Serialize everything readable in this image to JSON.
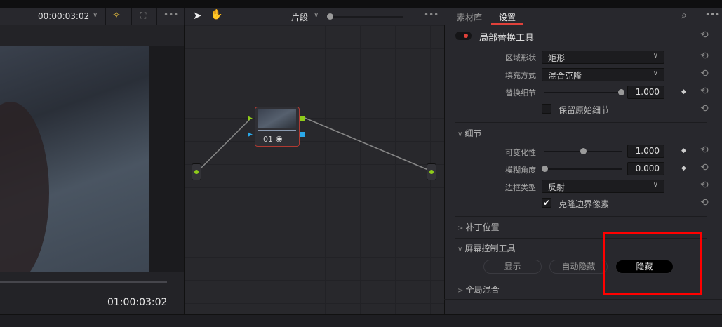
{
  "toolbar": {
    "timecode": "00:00:03:02",
    "clip_mode": "片段"
  },
  "viewer": {
    "timecode": "01:00:03:02"
  },
  "node": {
    "label": "01"
  },
  "panel": {
    "tabs": [
      {
        "label": "素材库"
      },
      {
        "label": "设置"
      }
    ],
    "tool_title": "局部替换工具",
    "region_shape": {
      "label": "区域形状",
      "value": "矩形"
    },
    "fill_mode": {
      "label": "填充方式",
      "value": "混合克隆"
    },
    "replace_detail": {
      "label": "替换细节",
      "value": "1.000"
    },
    "keep_detail": {
      "label": "保留原始细节",
      "checked": false
    },
    "detail_section": "细节",
    "variability": {
      "label": "可变化性",
      "value": "1.000"
    },
    "blur_angle": {
      "label": "模糊角度",
      "value": "0.000"
    },
    "border_type": {
      "label": "边框类型",
      "value": "反射"
    },
    "clone_border": {
      "label": "克隆边界像素",
      "checked": true
    },
    "patch_section": "补丁位置",
    "screen_section": "屏幕控制工具",
    "screen_buttons": [
      {
        "label": "显示"
      },
      {
        "label": "自动隐藏"
      },
      {
        "label": "隐藏"
      }
    ],
    "global_section": "全局混合"
  },
  "colors": {
    "accent": "#e0413a",
    "highlight_box": "#ff0000",
    "node_green": "#8fcc1a",
    "node_blue": "#2aa8e8"
  }
}
